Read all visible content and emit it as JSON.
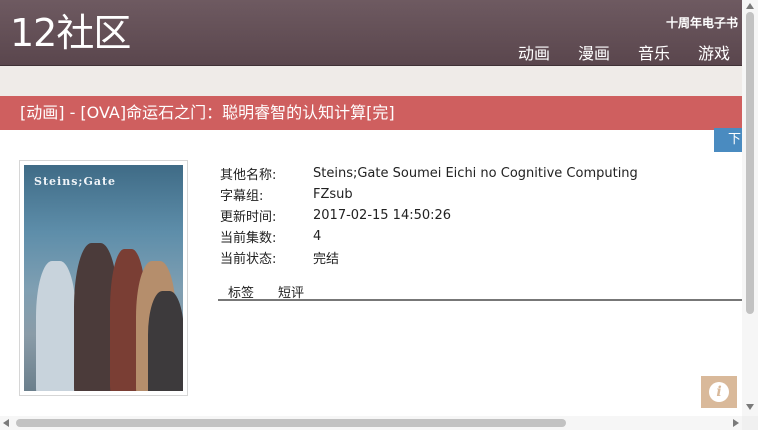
{
  "header": {
    "logo": "12社区",
    "tagline": "十周年电子书",
    "nav": [
      {
        "label": "动画"
      },
      {
        "label": "漫画"
      },
      {
        "label": "音乐"
      },
      {
        "label": "游戏"
      }
    ]
  },
  "title": "[动画] - [OVA]命运石之门：聪明睿智的认知计算[完]",
  "download_tab": "下",
  "cover": {
    "logo_text": "Steins;Gate"
  },
  "info": {
    "rows": [
      {
        "label": "其他名称:",
        "value": "Steins;Gate Soumei Eichi no Cognitive Computing"
      },
      {
        "label": "字幕组:",
        "value": "FZsub"
      },
      {
        "label": "更新时间:",
        "value": "2017-02-15 14:50:26"
      },
      {
        "label": "当前集数:",
        "value": "4"
      },
      {
        "label": "当前状态:",
        "value": "完结"
      }
    ]
  },
  "tabs": [
    {
      "label": "标签"
    },
    {
      "label": "短评"
    }
  ],
  "help_icon": "i",
  "colors": {
    "header": "#5f4b52",
    "title_bar": "#cf5f5f",
    "download_tab": "#4a8bc0",
    "help_button": "#d9b99a"
  }
}
